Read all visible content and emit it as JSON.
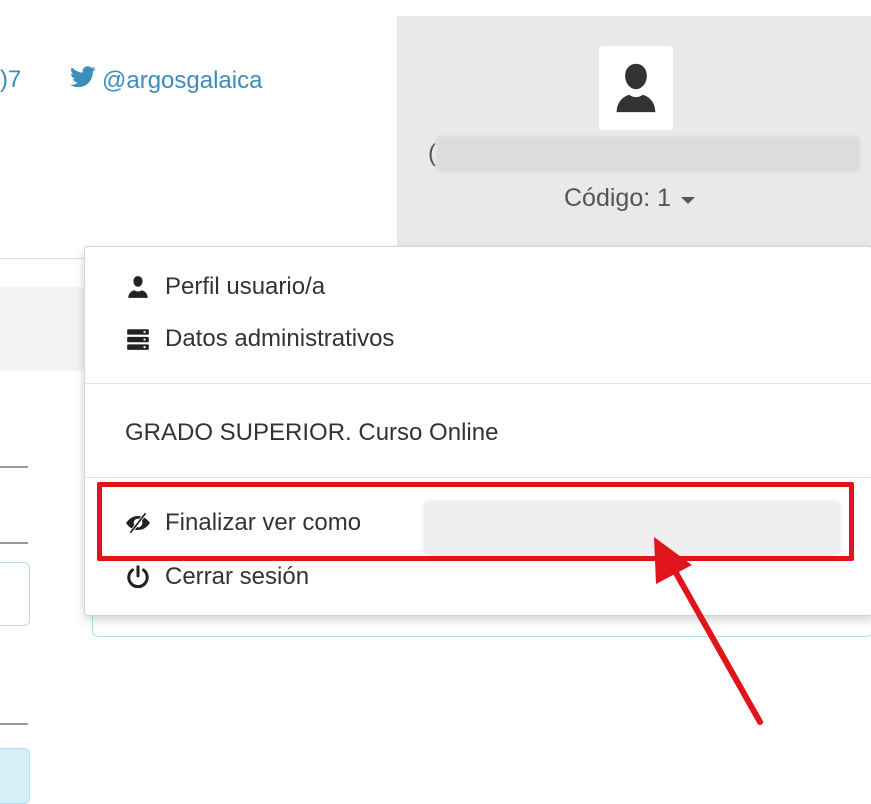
{
  "header": {
    "phone_fragment": ")7",
    "twitter_handle": "@argosgalaica"
  },
  "user": {
    "name_prefix": "(",
    "code_label": "Código: 1"
  },
  "menu": {
    "items": [
      {
        "label": "Perfil usuario/a",
        "icon": "user-icon"
      },
      {
        "label": "Datos administrativos",
        "icon": "server-icon"
      }
    ],
    "course": "GRADO SUPERIOR. Curso Online",
    "actions": [
      {
        "label": "Finalizar ver como",
        "icon": "eye-slash-icon"
      },
      {
        "label": "Cerrar sesión",
        "icon": "power-icon"
      }
    ]
  },
  "annotation": {
    "highlight_color": "#e0141a",
    "arrow_color": "#e0141a"
  },
  "colors": {
    "link": "#3c8dbc",
    "panel_bg": "#e9e9e9"
  }
}
